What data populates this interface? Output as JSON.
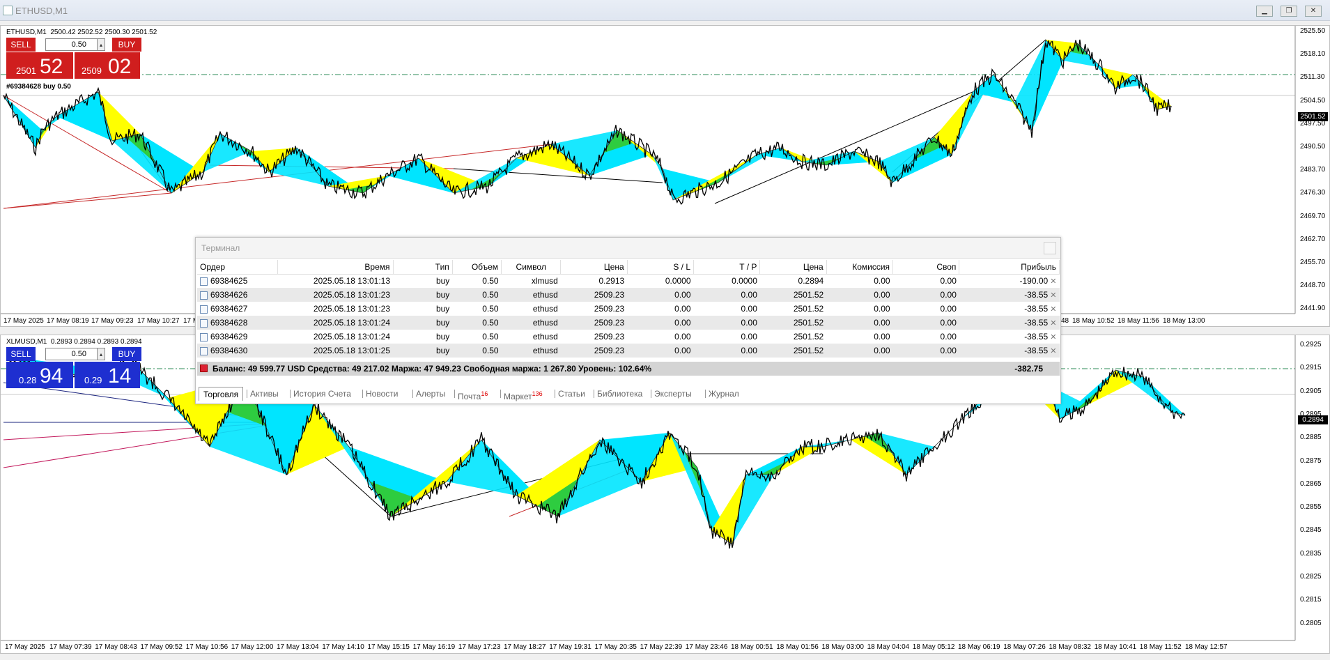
{
  "window": {
    "title": "ETHUSD,M1"
  },
  "colors": {
    "sell": "#d01e1e",
    "buy_top": "#d01e1e",
    "sell_blue": "#1e2fd0",
    "zz_fill": "#00e5ff",
    "zz_yellow": "#ffff00",
    "zz_green": "#2ecc40",
    "price_line": "#000000",
    "grid_dash": "#2e8b57"
  },
  "charts": [
    {
      "symbol": "ETHUSD,M1",
      "ohlc": "2500.42 2502.52 2500.30 2501.52",
      "sell_label": "SELL",
      "buy_label": "BUY",
      "volume": "0.50",
      "sell_price_small": "2501",
      "sell_price_big": "52",
      "buy_price_small": "2509",
      "buy_price_big": "02",
      "order_label": "#69384628 buy 0.50",
      "current_price": "2501.52",
      "y_ticks": [
        "2525.50",
        "2518.10",
        "2511.30",
        "2504.50",
        "2497.50",
        "2490.50",
        "2483.70",
        "2476.30",
        "2469.70",
        "2462.70",
        "2455.70",
        "2448.70",
        "2441.90"
      ],
      "x_ticks": [
        "17 May 2025",
        "17 May 08:19",
        "17 May 09:23",
        "17 May 10:27",
        "17 May",
        "…48",
        "18 May 10:52",
        "18 May 11:56",
        "18 May 13:00"
      ]
    },
    {
      "symbol": "XLMUSD,M1",
      "ohlc": "0.2893 0.2894 0.2893 0.2894",
      "sell_label": "SELL",
      "buy_label": "BUY",
      "volume": "0.50",
      "sell_price_small": "0.28",
      "sell_price_big": "94",
      "buy_price_small": "0.29",
      "buy_price_big": "14",
      "current_price": "0.2894",
      "y_ticks": [
        "0.2925",
        "0.2915",
        "0.2905",
        "0.2895",
        "0.2885",
        "0.2875",
        "0.2865",
        "0.2855",
        "0.2845",
        "0.2835",
        "0.2825",
        "0.2815",
        "0.2805"
      ],
      "x_ticks": [
        "17 May 2025",
        "17 May 07:39",
        "17 May 08:43",
        "17 May 09:52",
        "17 May 10:56",
        "17 May 12:00",
        "17 May 13:04",
        "17 May 14:10",
        "17 May 15:15",
        "17 May 16:19",
        "17 May 17:23",
        "17 May 18:27",
        "17 May 19:31",
        "17 May 20:35",
        "17 May 22:39",
        "17 May 23:46",
        "18 May 00:51",
        "18 May 01:56",
        "18 May 03:00",
        "18 May 04:04",
        "18 May 05:12",
        "18 May 06:19",
        "18 May 07:26",
        "18 May 08:32",
        "18 May 10:41",
        "18 May 11:52",
        "18 May 12:57"
      ]
    }
  ],
  "terminal": {
    "title": "Терминал",
    "columns": [
      "Ордер",
      "Время",
      "Тип",
      "Объем",
      "Символ",
      "Цена",
      "S / L",
      "T / P",
      "Цена",
      "Комиссия",
      "Своп",
      "Прибыль"
    ],
    "rows": [
      [
        "69384625",
        "2025.05.18 13:01:13",
        "buy",
        "0.50",
        "xlmusd",
        "0.2913",
        "0.0000",
        "0.0000",
        "0.2894",
        "0.00",
        "0.00",
        "-190.00"
      ],
      [
        "69384626",
        "2025.05.18 13:01:23",
        "buy",
        "0.50",
        "ethusd",
        "2509.23",
        "0.00",
        "0.00",
        "2501.52",
        "0.00",
        "0.00",
        "-38.55"
      ],
      [
        "69384627",
        "2025.05.18 13:01:23",
        "buy",
        "0.50",
        "ethusd",
        "2509.23",
        "0.00",
        "0.00",
        "2501.52",
        "0.00",
        "0.00",
        "-38.55"
      ],
      [
        "69384628",
        "2025.05.18 13:01:24",
        "buy",
        "0.50",
        "ethusd",
        "2509.23",
        "0.00",
        "0.00",
        "2501.52",
        "0.00",
        "0.00",
        "-38.55"
      ],
      [
        "69384629",
        "2025.05.18 13:01:24",
        "buy",
        "0.50",
        "ethusd",
        "2509.23",
        "0.00",
        "0.00",
        "2501.52",
        "0.00",
        "0.00",
        "-38.55"
      ],
      [
        "69384630",
        "2025.05.18 13:01:25",
        "buy",
        "0.50",
        "ethusd",
        "2509.23",
        "0.00",
        "0.00",
        "2501.52",
        "0.00",
        "0.00",
        "-38.55"
      ]
    ],
    "balance_text": "Баланс: 49 599.77 USD  Средства: 49 217.02  Маржа: 47 949.23  Свободная маржа: 1 267.80  Уровень: 102.64%",
    "total_profit": "-382.75",
    "tabs": [
      {
        "label": "Торговля",
        "badge": ""
      },
      {
        "label": "Активы",
        "badge": ""
      },
      {
        "label": "История Счета",
        "badge": ""
      },
      {
        "label": "Новости",
        "badge": ""
      },
      {
        "label": "Алерты",
        "badge": ""
      },
      {
        "label": "Почта",
        "badge": "16"
      },
      {
        "label": "Маркет",
        "badge": "136"
      },
      {
        "label": "Статьи",
        "badge": ""
      },
      {
        "label": "Библиотека",
        "badge": ""
      },
      {
        "label": "Эксперты",
        "badge": ""
      },
      {
        "label": "Журнал",
        "badge": ""
      }
    ]
  }
}
